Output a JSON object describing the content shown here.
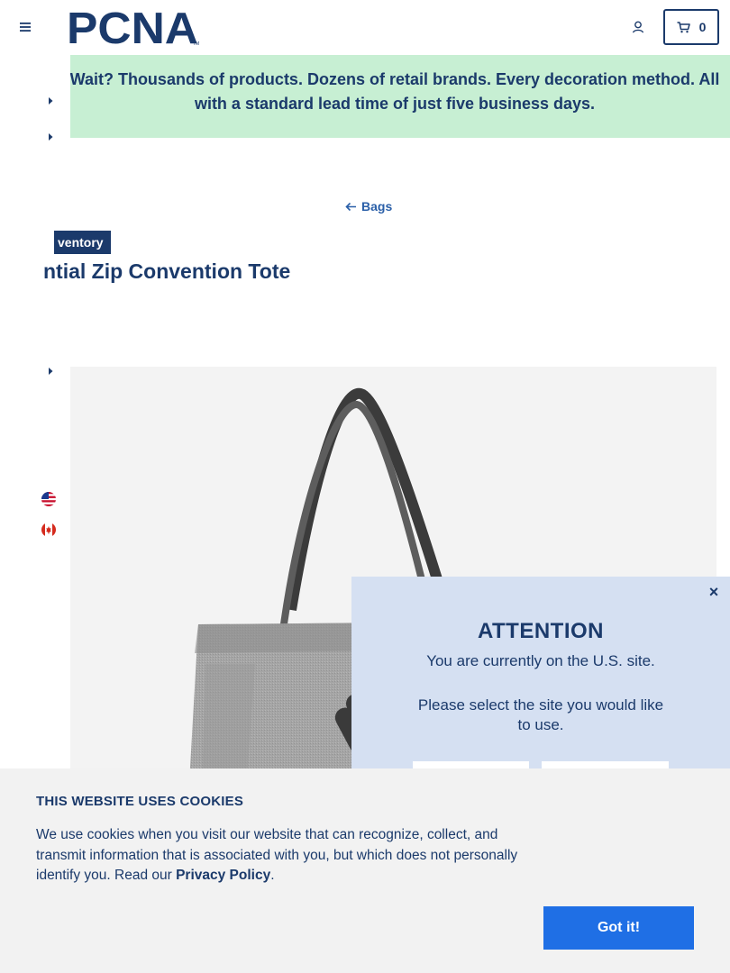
{
  "header": {
    "logo_text": "PCNA",
    "logo_tm": "TM",
    "cart_count": "0"
  },
  "promo": {
    "text": "Wait? Thousands of products. Dozens of retail brands. Every decoration method. All with a standard lead time of just five business days."
  },
  "breadcrumb": {
    "label": "Bags"
  },
  "product": {
    "badge": "ventory",
    "title": "ntial Zip Convention Tote"
  },
  "site_popup": {
    "title": "ATTENTION",
    "current_site": "You are currently on the U.S. site.",
    "instruction": "Please select the site you would like to use.",
    "close": "×"
  },
  "cookie_banner": {
    "title": "THIS WEBSITE USES COOKIES",
    "body_before_link": "We use cookies when you visit our website that can recognize, collect, and transmit information that is associated with you, but which does not personally identify you. Read our ",
    "link_label": "Privacy Policy",
    "body_after_link": ".",
    "accept_label": "Got it!"
  },
  "colors": {
    "brand_navy": "#1b3a6b",
    "promo_bg": "#c7efd3",
    "accept_blue": "#1f6fe5",
    "popup_bg": "#d5e0f2"
  },
  "icons": [
    "menu-icon",
    "pcna-logo",
    "user-icon",
    "cart-icon",
    "caret-right-icon",
    "arrow-left-icon",
    "us-flag-icon",
    "canada-flag-icon",
    "close-icon"
  ]
}
